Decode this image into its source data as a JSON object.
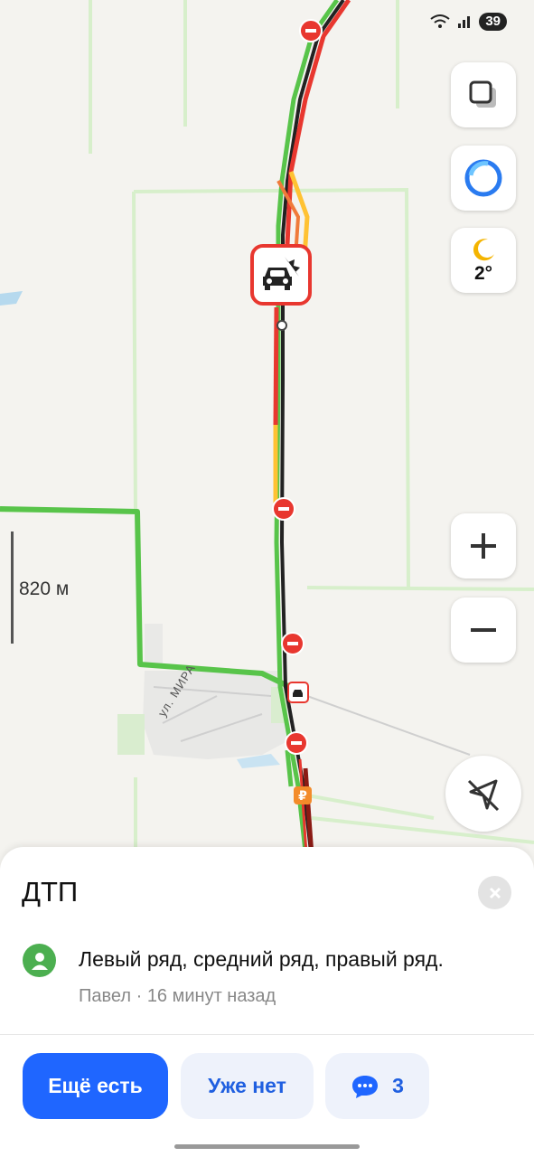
{
  "status_bar": {
    "battery": "39"
  },
  "map": {
    "scale_label": "820 м",
    "street_label": "ул. МИРА",
    "weather_temp": "2°",
    "traffic_colors": {
      "jam": "#e8372f",
      "slow": "#ffc233",
      "free": "#41c337",
      "heavy": "#8b1a14",
      "route": "#58c44a"
    }
  },
  "incident": {
    "title": "ДТП",
    "comment": "Левый ряд, средний ряд, правый ряд.",
    "author": "Павел",
    "time_ago": "16 минут назад",
    "meta_sep": " · "
  },
  "actions": {
    "still_there": "Ещё есть",
    "gone": "Уже нет",
    "comments_count": "3"
  },
  "icons": {
    "layers": "layers-icon",
    "alice": "alice-icon",
    "weather": "moon-icon",
    "zoom_in": "plus-icon",
    "zoom_out": "minus-icon",
    "compass": "navigation-off-icon",
    "close": "close-icon",
    "chat": "chat-icon",
    "accident": "car-crash-icon",
    "road_closed": "no-entry-icon",
    "gas": "ruble-icon"
  }
}
